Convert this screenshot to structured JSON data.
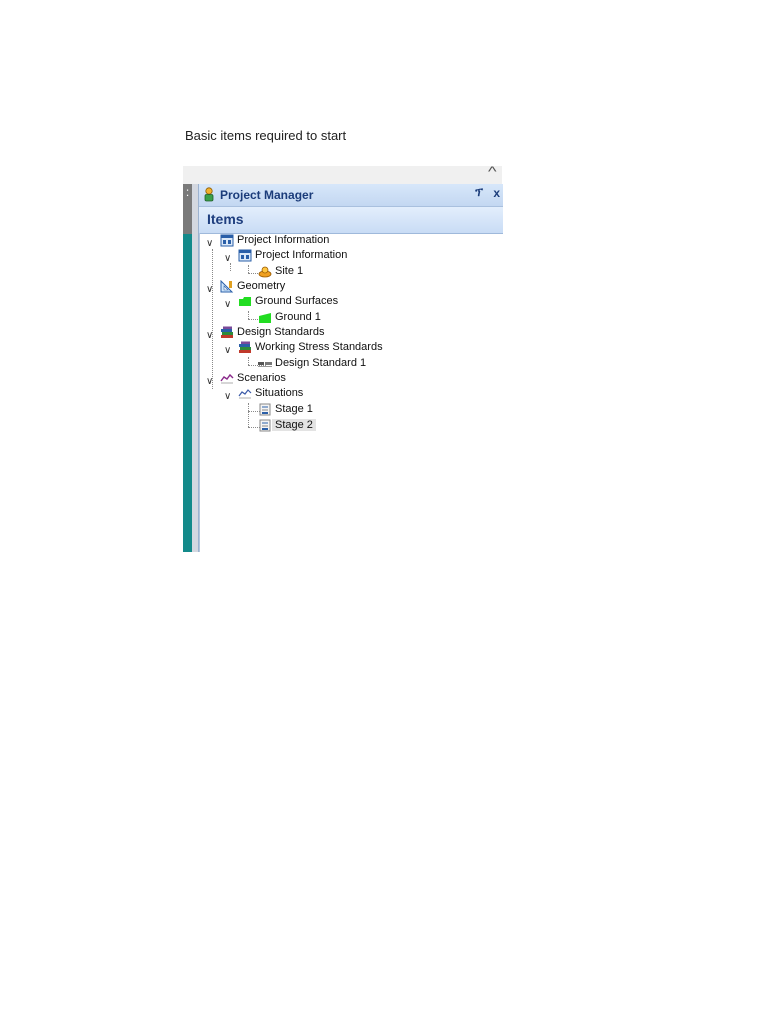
{
  "caption": "Basic items required to start",
  "panel": {
    "title": "Project Manager",
    "pin_glyph": "ፕ",
    "close_glyph": "x",
    "items_heading": "Items"
  },
  "tree": {
    "project_information": "Project Information",
    "project_information_child": "Project Information",
    "site": "Site 1",
    "geometry": "Geometry",
    "ground_surfaces": "Ground Surfaces",
    "ground": "Ground 1",
    "design_standards": "Design Standards",
    "working_stress": "Working Stress Standards",
    "design_standard": "Design Standard 1",
    "scenarios": "Scenarios",
    "situations": "Situations",
    "stage1": "Stage 1",
    "stage2": "Stage 2"
  },
  "icons": {
    "project-information": "window-grid-icon",
    "site": "orange-pin-icon",
    "geometry": "ruler-triangle-icon",
    "ground-surfaces": "green-folder-icon",
    "ground": "green-surface-icon",
    "design-standards": "books-icon",
    "design-standard": "standard-icon",
    "scenarios": "chart-line-icon",
    "stage": "stage-doc-icon"
  },
  "colors": {
    "accent_teal": "#138a8a",
    "header_text": "#1b3c7a",
    "selection": "#e3e3e3"
  }
}
